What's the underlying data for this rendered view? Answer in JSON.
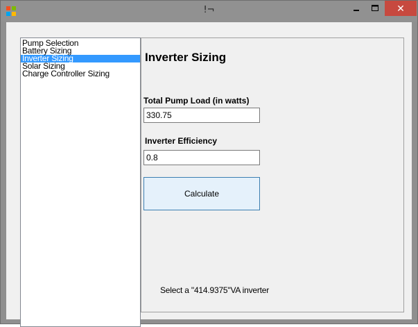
{
  "window": {
    "title": "!¬",
    "close_glyph": "✕"
  },
  "nav": {
    "items": [
      {
        "label": "Pump Selection",
        "selected": false
      },
      {
        "label": "Battery Sizing",
        "selected": false
      },
      {
        "label": "Inverter Sizing",
        "selected": true
      },
      {
        "label": "Solar Sizing",
        "selected": false
      },
      {
        "label": "Charge Controller Sizing",
        "selected": false
      }
    ]
  },
  "panel": {
    "title": "Inverter Sizing",
    "load_label": "Total Pump Load (in watts)",
    "load_value": "330.75",
    "efficiency_label": "Inverter Efficiency",
    "efficiency_value": "0.8",
    "calculate_label": "Calculate",
    "result_text": "Select a \"414.9375\"VA inverter"
  },
  "colors": {
    "selection": "#3399ff",
    "close_button": "#c7493f",
    "button_border": "#3c7fb1"
  },
  "icons": {
    "app": "app-icon",
    "minimize": "minimize-icon",
    "maximize": "maximize-icon",
    "close": "close-icon"
  }
}
